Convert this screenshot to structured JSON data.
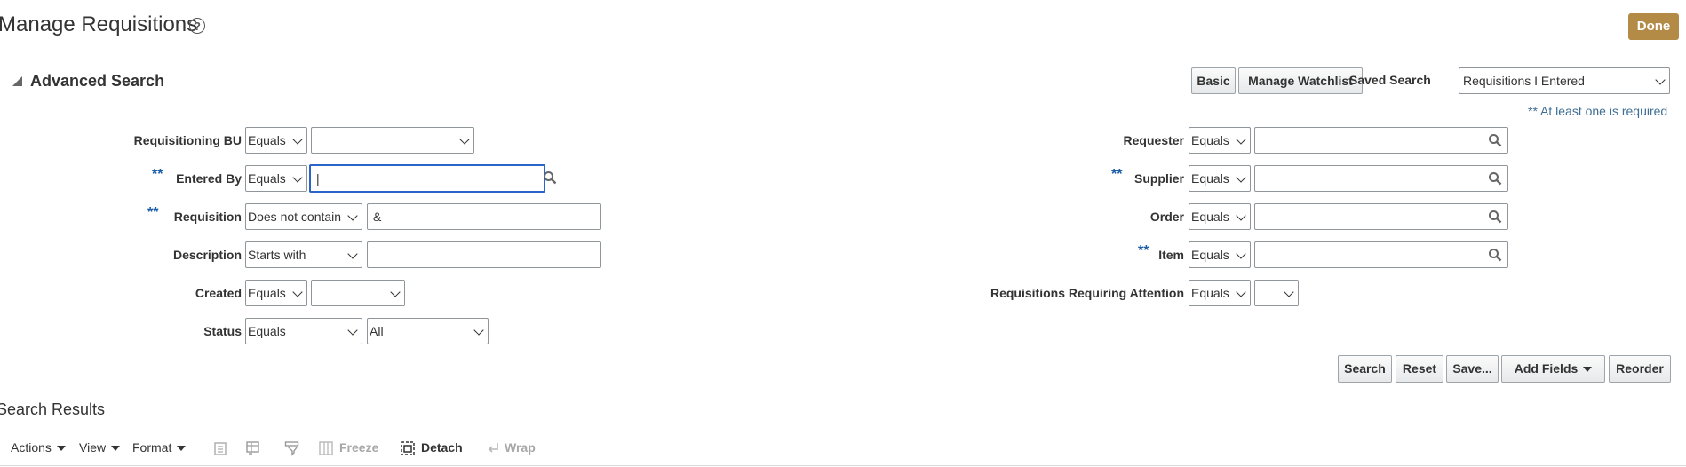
{
  "header": {
    "title": "Manage Requisitions",
    "help_glyph": "?",
    "done_label": "Done"
  },
  "advanced": {
    "title": "Advanced Search",
    "basic_label": "Basic",
    "watchlist_label": "Manage Watchlist",
    "saved_search_label": "Saved Search",
    "saved_search_value": "Requisitions I Entered",
    "required_note": "** At least one is required",
    "required_marker": "**"
  },
  "left_fields": {
    "requisitioning_bu": {
      "label": "Requisitioning BU",
      "operator": "Equals",
      "value": ""
    },
    "entered_by": {
      "label": "Entered By",
      "operator": "Equals",
      "value": "|"
    },
    "requisition": {
      "label": "Requisition",
      "operator": "Does not contain",
      "value": "&"
    },
    "description": {
      "label": "Description",
      "operator": "Starts with",
      "value": ""
    },
    "created": {
      "label": "Created",
      "operator": "Equals",
      "value": ""
    },
    "status": {
      "label": "Status",
      "operator": "Equals",
      "value": "All"
    }
  },
  "right_fields": {
    "requester": {
      "label": "Requester",
      "operator": "Equals",
      "value": ""
    },
    "supplier": {
      "label": "Supplier",
      "operator": "Equals",
      "value": ""
    },
    "order": {
      "label": "Order",
      "operator": "Equals",
      "value": ""
    },
    "item": {
      "label": "Item",
      "operator": "Equals",
      "value": ""
    },
    "attention": {
      "label": "Requisitions Requiring Attention",
      "operator": "Equals",
      "value": ""
    }
  },
  "actions": {
    "search": "Search",
    "reset": "Reset",
    "save": "Save...",
    "add_fields": "Add Fields",
    "reorder": "Reorder"
  },
  "results": {
    "title": "Search Results",
    "toolbar": {
      "actions": "Actions",
      "view": "View",
      "format": "Format",
      "freeze": "Freeze",
      "detach": "Detach",
      "wrap": "Wrap"
    }
  },
  "colors": {
    "accent": "#b38b47",
    "required": "#1c5fa8",
    "focus": "#2a64c8",
    "note": "#3f6f94"
  },
  "icons": [
    "help-icon",
    "search-icon",
    "chevron-down-icon",
    "collapse-triangle-icon",
    "export-icon",
    "grid-icon",
    "filter-icon",
    "freeze-icon",
    "detach-icon",
    "wrap-icon"
  ]
}
